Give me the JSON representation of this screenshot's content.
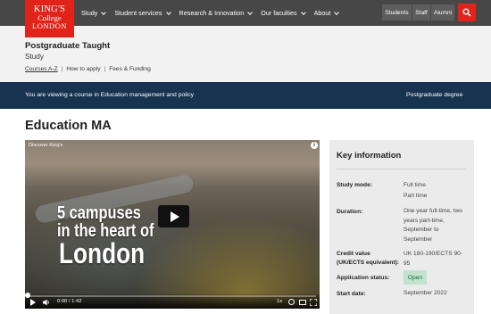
{
  "brand": {
    "line1": "KING'S",
    "line2": "College",
    "line3": "LONDON",
    "color": "#e2231a"
  },
  "nav": {
    "items": [
      {
        "label": "Study"
      },
      {
        "label": "Student services"
      },
      {
        "label": "Research & Innovation"
      },
      {
        "label": "Our faculties"
      },
      {
        "label": "About"
      }
    ],
    "audience": {
      "students": "Students",
      "staff": "Staff",
      "alumni": "Alumni"
    },
    "search_icon": "search-icon"
  },
  "study_header": {
    "title": "Postgraduate Taught",
    "subtitle": "Study",
    "links": {
      "courses": "Courses A-Z",
      "apply": "How to apply",
      "fees": "Fees & Funding"
    },
    "separator": "|"
  },
  "banner": {
    "text": "You are viewing a course in Education management and policy",
    "right": "Postgraduate degree",
    "color": "#17334f"
  },
  "page_title": "Education MA",
  "video": {
    "label": "Discover King's",
    "headline": [
      "5 campuses",
      "in the heart of",
      "London"
    ],
    "current_time": "0:00",
    "duration": "1:42",
    "time_separator": " / ",
    "speed": "1x",
    "progress": 0
  },
  "key_info": {
    "title": "Key information",
    "rows": [
      {
        "label": "Study mode:",
        "value": "Full time\nPart time"
      },
      {
        "label": "Duration:",
        "value": "One year full-time, two years part-time, September to September"
      },
      {
        "label": "Credit value (UK/ECTS equivalent):",
        "value": "UK 180-190/ECTS 90-95"
      },
      {
        "label": "Application status:",
        "value": "Open"
      },
      {
        "label": "Start date:",
        "value": "September 2022"
      }
    ],
    "status_color": "#bfe3cf"
  }
}
